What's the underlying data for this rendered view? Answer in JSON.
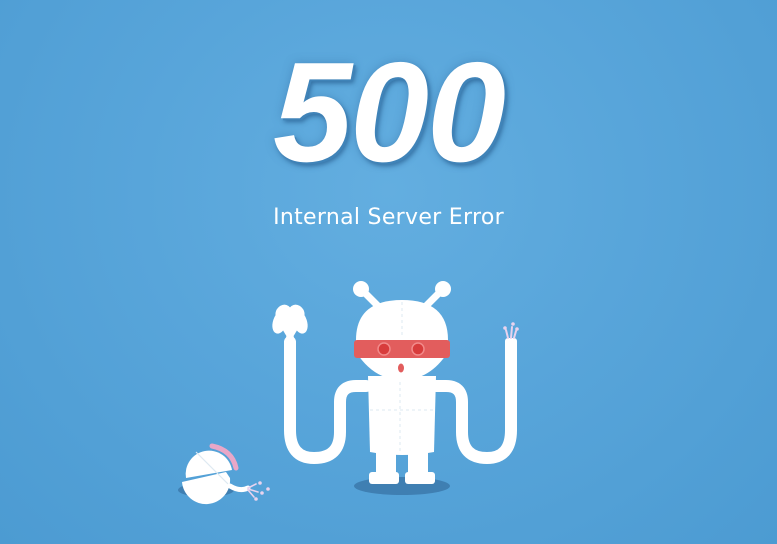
{
  "error": {
    "code": "500",
    "message": "Internal Server Error"
  },
  "illustration": {
    "subject": "robot-with-scissors-and-cut-cable",
    "icons": [
      "robot-illustration",
      "scissors-icon",
      "broken-cable-icon",
      "detached-ball-icon"
    ]
  },
  "colors": {
    "background": "#58a5da",
    "text": "#ffffff",
    "robot_body": "#ffffff",
    "robot_visor": "#e25d5d",
    "robot_eye": "#d83c3c",
    "shadow": "#3f7fb2",
    "ball_accent": "#e8a7c8"
  }
}
